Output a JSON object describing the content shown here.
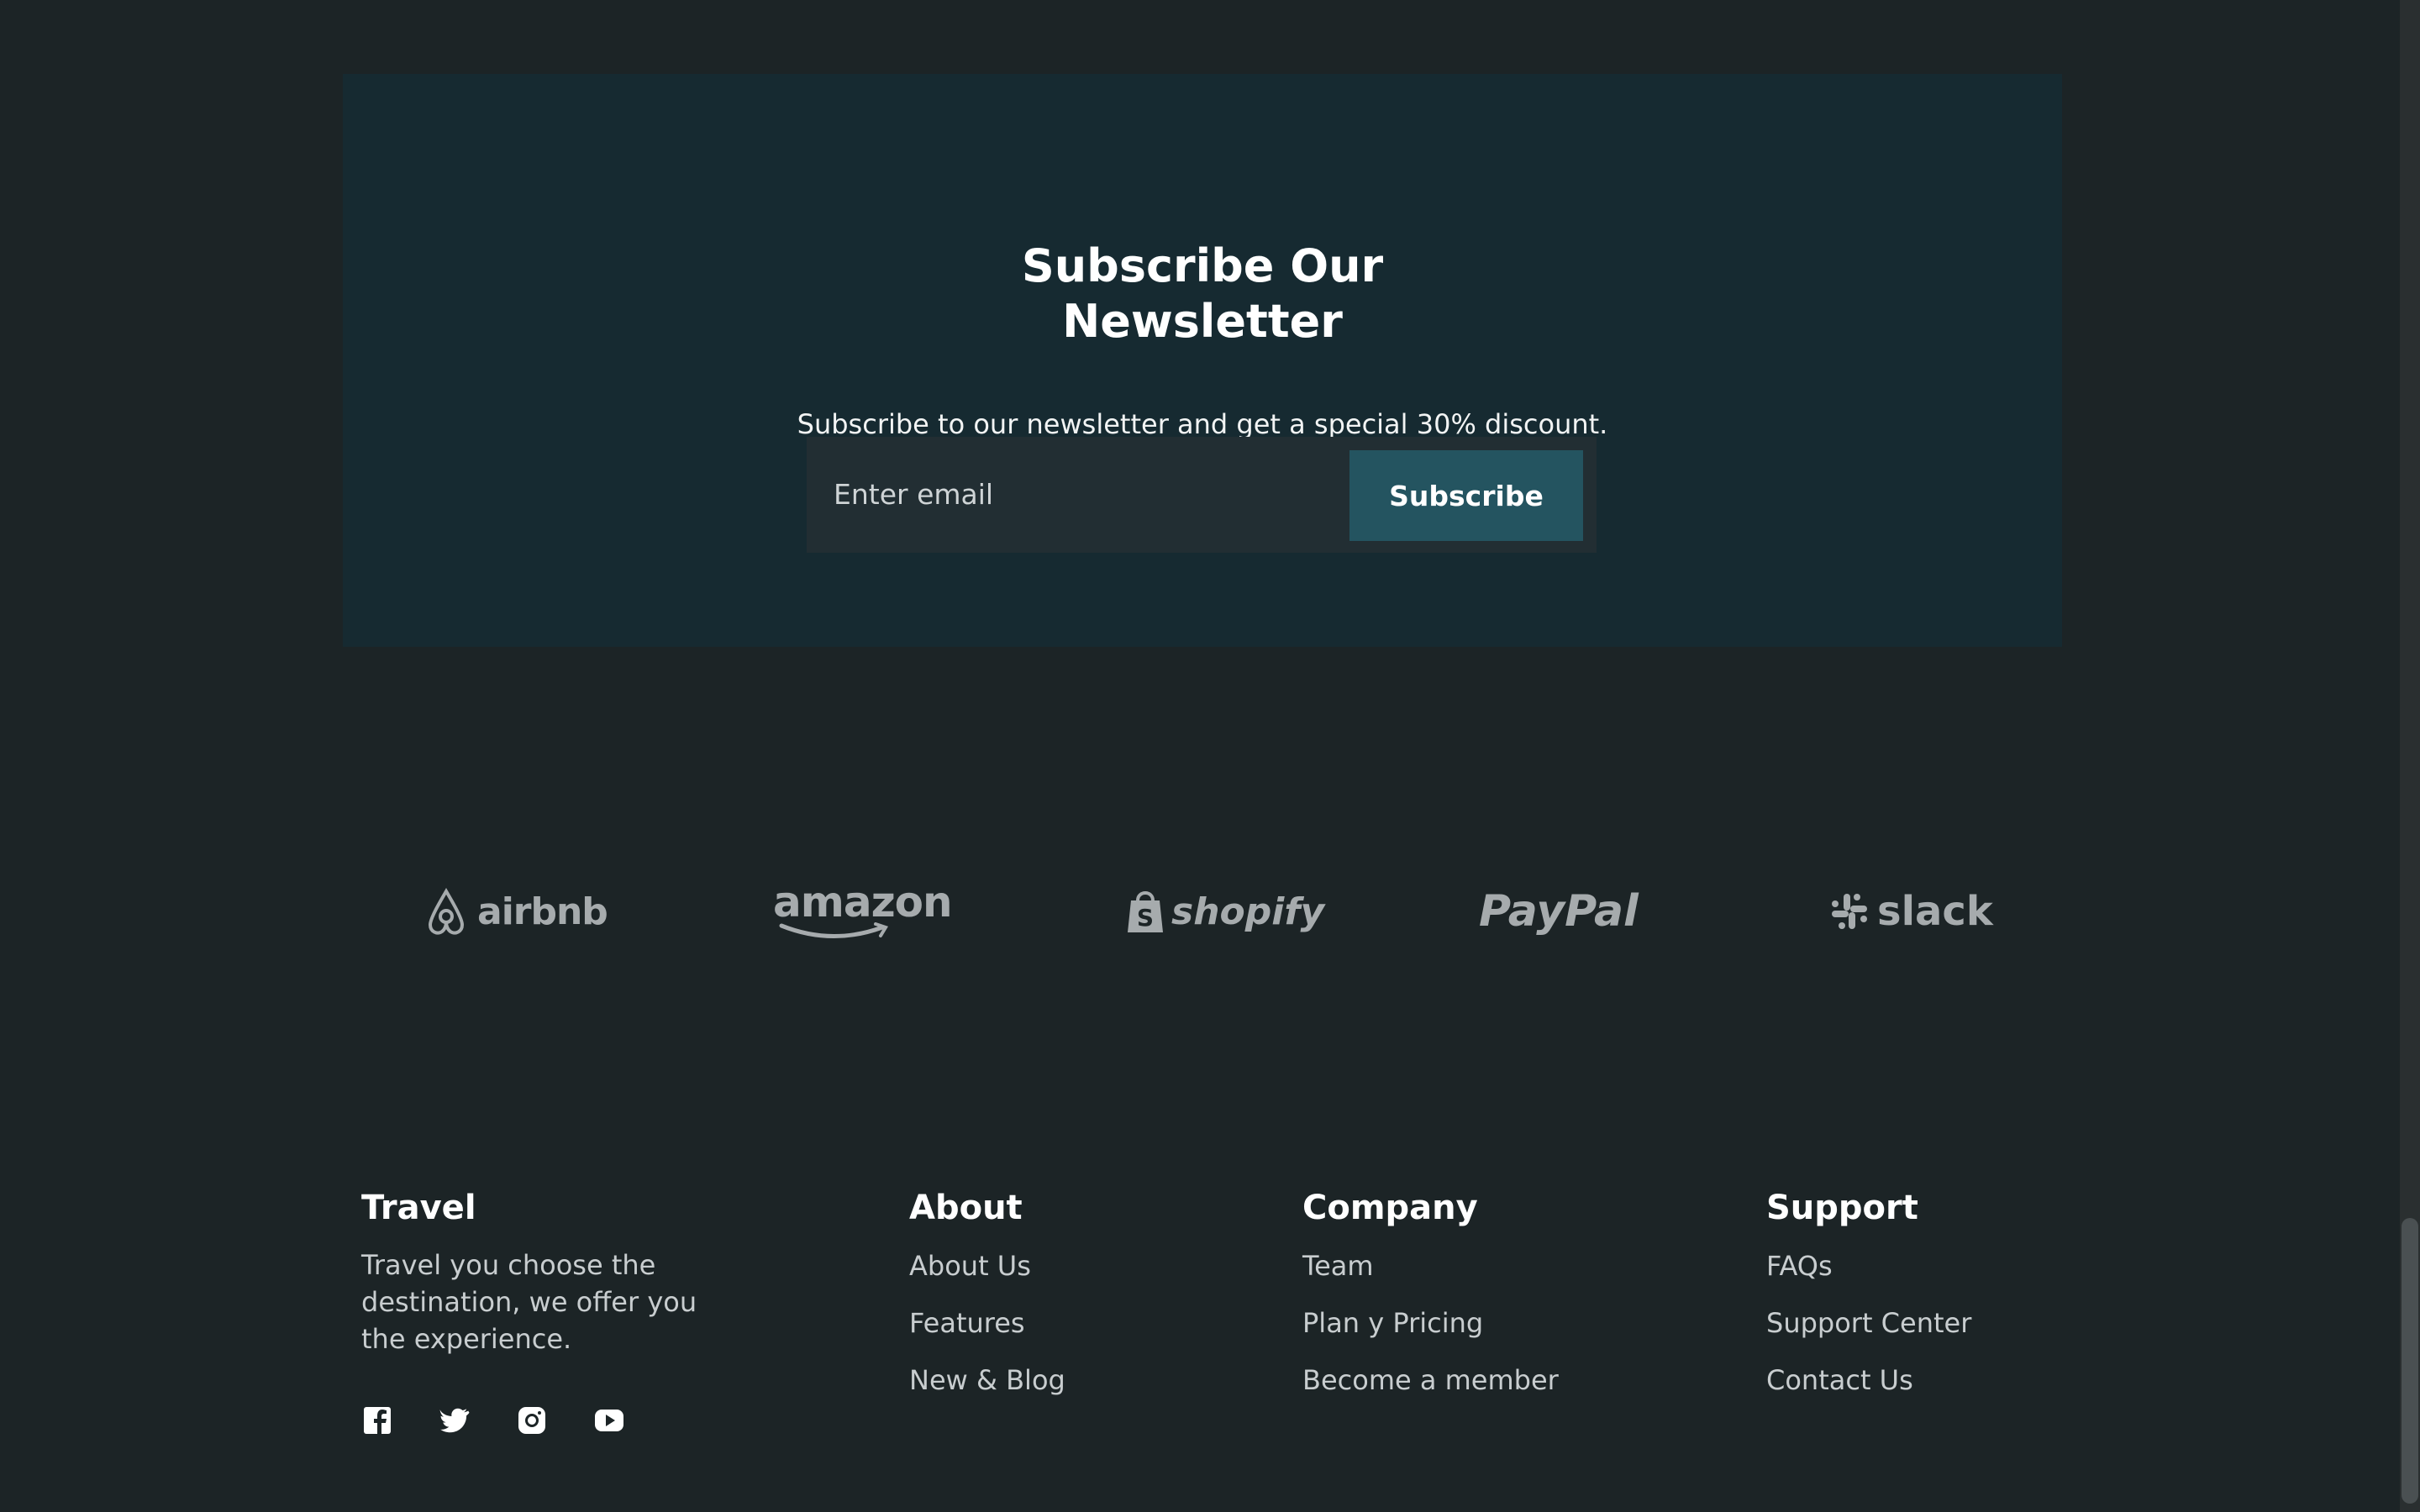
{
  "newsletter": {
    "title_line1": "Subscribe Our",
    "title_line2": "Newsletter",
    "description": "Subscribe to our newsletter and get a special 30% discount.",
    "email_placeholder": "Enter email",
    "button_label": "Subscribe"
  },
  "brands": [
    {
      "name": "airbnb",
      "icon": "airbnb-logo"
    },
    {
      "name": "amazon",
      "icon": "amazon-logo"
    },
    {
      "name": "shopify",
      "icon": "shopify-logo"
    },
    {
      "name": "PayPal",
      "icon": "paypal-logo"
    },
    {
      "name": "slack",
      "icon": "slack-logo"
    }
  ],
  "footer": {
    "travel": {
      "heading": "Travel",
      "text": "Travel you choose the destination, we offer you the experience."
    },
    "about": {
      "heading": "About",
      "links": [
        "About Us",
        "Features",
        "New & Blog"
      ]
    },
    "company": {
      "heading": "Company",
      "links": [
        "Team",
        "Plan y Pricing",
        "Become a member"
      ]
    },
    "support": {
      "heading": "Support",
      "links": [
        "FAQs",
        "Support Center",
        "Contact Us"
      ]
    },
    "socials": [
      "facebook-icon",
      "twitter-icon",
      "instagram-icon",
      "youtube-icon"
    ]
  },
  "colors": {
    "page_bg": "#1c2426",
    "newsletter_bg": "#162a31",
    "button_bg": "#245460",
    "logo_gray": "#a6abad"
  }
}
